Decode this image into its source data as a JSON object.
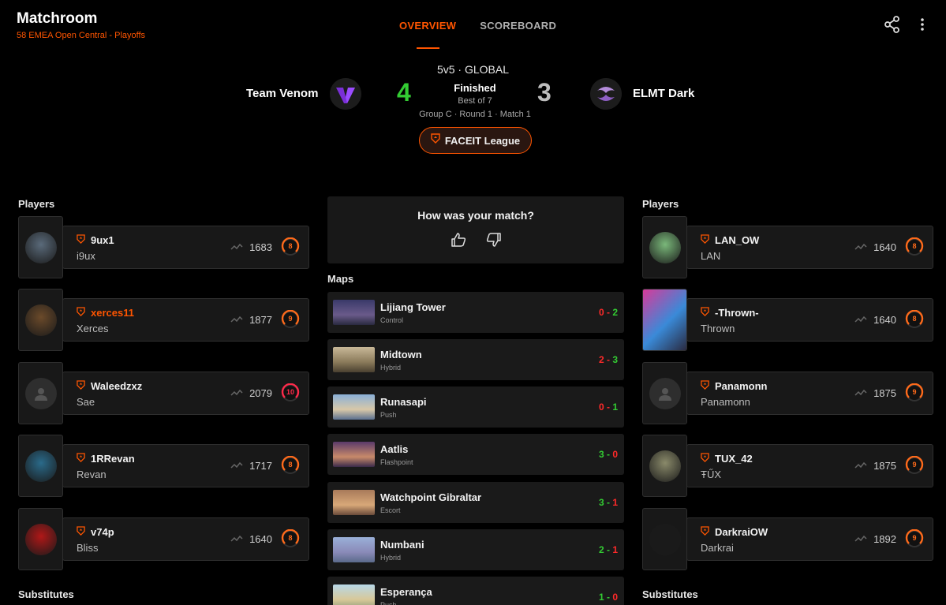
{
  "header": {
    "title": "Matchroom",
    "subtitle": "58 EMEA Open Central - Playoffs",
    "tabs": [
      "OVERVIEW",
      "SCOREBOARD"
    ],
    "icons": [
      "share-icon",
      "more-vertical-icon"
    ]
  },
  "match": {
    "mode": "5v5 · GLOBAL",
    "team1": {
      "name": "Team Venom",
      "score": "4"
    },
    "team2": {
      "name": "ELMT Dark",
      "score": "3"
    },
    "status": "Finished",
    "best_of": "Best of 7",
    "group": "Group C · Round 1 · Match 1",
    "league": "FACEIT League"
  },
  "colors": {
    "accent": "#ff5500",
    "win": "#33cc33",
    "loss": "#ff2a2a",
    "card": "#181818"
  },
  "left": {
    "title": "Players",
    "substitutes": "Substitutes",
    "players": [
      {
        "nick": "9ux1",
        "name": "i9ux",
        "elo": "1683",
        "level": "8"
      },
      {
        "nick": "xerces11",
        "name": "Xerces",
        "elo": "1877",
        "level": "9"
      },
      {
        "nick": "Waleedzxz",
        "name": "Sae",
        "elo": "2079",
        "level": "10"
      },
      {
        "nick": "1RRevan",
        "name": "Revan",
        "elo": "1717",
        "level": "8"
      },
      {
        "nick": "v74p",
        "name": "Bliss",
        "elo": "1640",
        "level": "8"
      }
    ]
  },
  "right": {
    "title": "Players",
    "substitutes": "Substitutes",
    "players": [
      {
        "nick": "LAN_OW",
        "name": "LAN",
        "elo": "1640",
        "level": "8"
      },
      {
        "nick": "-Thrown-",
        "name": "Thrown",
        "elo": "1640",
        "level": "8"
      },
      {
        "nick": "Panamonn",
        "name": "Panamonn",
        "elo": "1875",
        "level": "9"
      },
      {
        "nick": "TUX_42",
        "name": "ŦŰX",
        "elo": "1875",
        "level": "9"
      },
      {
        "nick": "DarkraiOW",
        "name": "Darkrai",
        "elo": "1892",
        "level": "9"
      }
    ]
  },
  "feedback": {
    "question": "How was your match?"
  },
  "maps": {
    "title": "Maps",
    "items": [
      {
        "name": "Lijiang Tower",
        "type": "Control",
        "s1": "0",
        "s2": "2"
      },
      {
        "name": "Midtown",
        "type": "Hybrid",
        "s1": "2",
        "s2": "3"
      },
      {
        "name": "Runasapi",
        "type": "Push",
        "s1": "0",
        "s2": "1"
      },
      {
        "name": "Aatlis",
        "type": "Flashpoint",
        "s1": "3",
        "s2": "0"
      },
      {
        "name": "Watchpoint Gibraltar",
        "type": "Escort",
        "s1": "3",
        "s2": "1"
      },
      {
        "name": "Numbani",
        "type": "Hybrid",
        "s1": "2",
        "s2": "1"
      },
      {
        "name": "Esperança",
        "type": "Push",
        "s1": "1",
        "s2": "0"
      }
    ]
  }
}
